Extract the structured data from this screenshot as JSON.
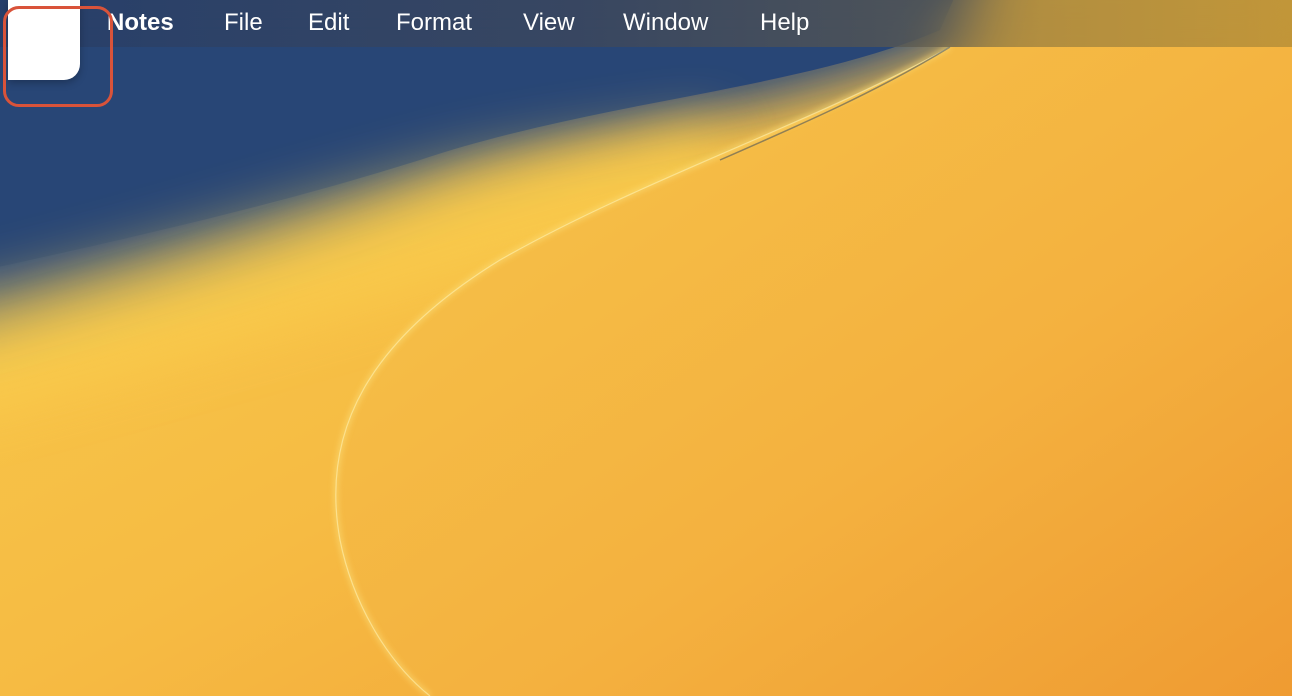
{
  "menubar": {
    "apple_menu_icon": "apple-icon",
    "items": [
      {
        "label": "Notes",
        "bold": true
      },
      {
        "label": "File"
      },
      {
        "label": "Edit"
      },
      {
        "label": "Format"
      },
      {
        "label": "View"
      },
      {
        "label": "Window"
      },
      {
        "label": "Help"
      }
    ]
  },
  "colors": {
    "highlight_ring": "#d9533a",
    "wallpaper_blue": "#2a4a7c",
    "wallpaper_yellow": "#f9c94a",
    "wallpaper_orange": "#f1a034"
  }
}
